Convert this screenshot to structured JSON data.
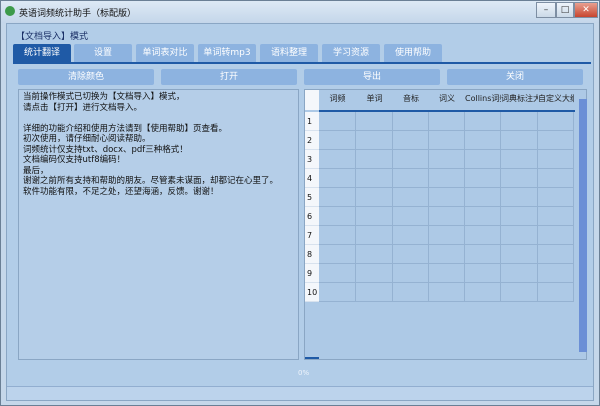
{
  "window": {
    "title": "英语词频统计助手（标配版）",
    "minimize": "–",
    "maximize": "□",
    "close": "✕"
  },
  "mode_label": "【文档导入】模式",
  "tabs": [
    {
      "label": "统计翻译"
    },
    {
      "label": "设置"
    },
    {
      "label": "单词表对比"
    },
    {
      "label": "单词转mp3"
    },
    {
      "label": "语料整理"
    },
    {
      "label": "学习资源"
    },
    {
      "label": "使用帮助"
    }
  ],
  "toolbar": {
    "clear_color": "清除颜色",
    "open": "打开",
    "export": "导出",
    "close": "关闭"
  },
  "info_text": "当前操作模式已切换为【文档导入】模式，\n请点击【打开】进行文档导入。\n\n详细的功能介绍和使用方法请到【使用帮助】页查看。\n初次使用，请仔细耐心阅读帮助。\n词频统计仅支持txt、docx、pdf三种格式！\n文档编码仅支持utf8编码！\n最后，\n谢谢之前所有支持和帮助的朋友。尽管素未谋面，却都记在心里了。\n软件功能有限，不足之处，还望海涵，反馈。谢谢！",
  "table": {
    "columns": [
      "词频",
      "单词",
      "音标",
      "词义",
      "Collins词频",
      "词典标注大纲",
      "自定义大纲"
    ],
    "rows": [
      "1",
      "2",
      "3",
      "4",
      "5",
      "6",
      "7",
      "8",
      "9",
      "10"
    ]
  },
  "progress": {
    "text": "0%",
    "value": 0
  }
}
